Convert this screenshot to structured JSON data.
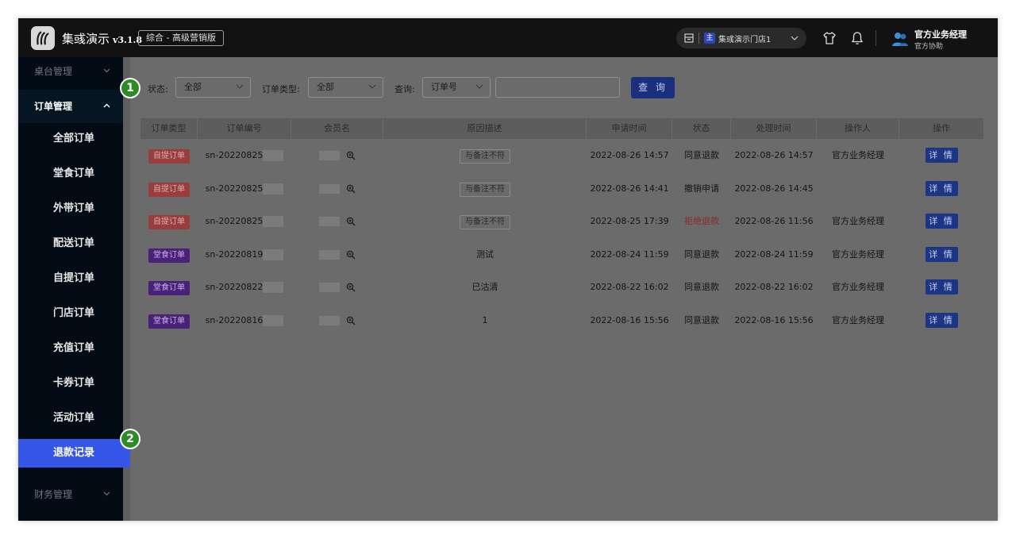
{
  "header": {
    "brand": "集彧演示",
    "version": "v3.1.8",
    "edition": "综合 - 高级营销版",
    "store_tag": "主",
    "store_name": "集彧演示门店1",
    "user_name": "官方业务经理",
    "user_role": "官方协助"
  },
  "sidebar": {
    "group_top": "桌台管理",
    "group_open": "订单管理",
    "items": [
      "全部订单",
      "堂食订单",
      "外带订单",
      "配送订单",
      "自提订单",
      "门店订单",
      "充值订单",
      "卡券订单",
      "活动订单",
      "退款记录"
    ],
    "active_item": "退款记录",
    "group_bottom": "财务管理"
  },
  "badges": [
    "1",
    "2"
  ],
  "filters": {
    "status_label": "状态:",
    "status_value": "全部",
    "type_label": "订单类型:",
    "type_value": "全部",
    "query_label": "查询:",
    "query_field": "订单号",
    "query_input": "",
    "search_button": "查 询"
  },
  "table": {
    "columns": [
      "订单类型",
      "订单编号",
      "会员名",
      "原因描述",
      "申请时间",
      "状态",
      "处理时间",
      "操作人",
      "操作"
    ],
    "rows": [
      {
        "type": "自提订单",
        "type_kind": "self",
        "order_no": "sn-20220825",
        "reason": "与备注不符",
        "reason_tag": true,
        "apply_time": "2022-08-26 14:57",
        "status": "同意退款",
        "status_kind": "normal",
        "process_time": "2022-08-26 14:57",
        "operator": "官方业务经理",
        "action": "详 情"
      },
      {
        "type": "自提订单",
        "type_kind": "self",
        "order_no": "sn-20220825",
        "reason": "与备注不符",
        "reason_tag": true,
        "apply_time": "2022-08-26 14:41",
        "status": "撤销申请",
        "status_kind": "normal",
        "process_time": "2022-08-26 14:45",
        "operator": "",
        "action": "详 情"
      },
      {
        "type": "自提订单",
        "type_kind": "self",
        "order_no": "sn-20220825",
        "reason": "与备注不符",
        "reason_tag": true,
        "apply_time": "2022-08-25 17:39",
        "status": "拒绝退款",
        "status_kind": "red",
        "process_time": "2022-08-26 11:56",
        "operator": "官方业务经理",
        "action": "详 情"
      },
      {
        "type": "堂食订单",
        "type_kind": "dine",
        "order_no": "sn-20220819",
        "reason": "测试",
        "reason_tag": false,
        "apply_time": "2022-08-24 11:59",
        "status": "同意退款",
        "status_kind": "normal",
        "process_time": "2022-08-24 11:59",
        "operator": "官方业务经理",
        "action": "详 情"
      },
      {
        "type": "堂食订单",
        "type_kind": "dine",
        "order_no": "sn-20220822",
        "reason": "已沽清",
        "reason_tag": false,
        "apply_time": "2022-08-22 16:02",
        "status": "同意退款",
        "status_kind": "normal",
        "process_time": "2022-08-22 16:02",
        "operator": "官方业务经理",
        "action": "详 情"
      },
      {
        "type": "堂食订单",
        "type_kind": "dine",
        "order_no": "sn-20220816",
        "reason": "1",
        "reason_tag": false,
        "apply_time": "2022-08-16 15:56",
        "status": "同意退款",
        "status_kind": "normal",
        "process_time": "2022-08-16 15:56",
        "operator": "官方业务经理",
        "action": "详 情"
      }
    ]
  }
}
